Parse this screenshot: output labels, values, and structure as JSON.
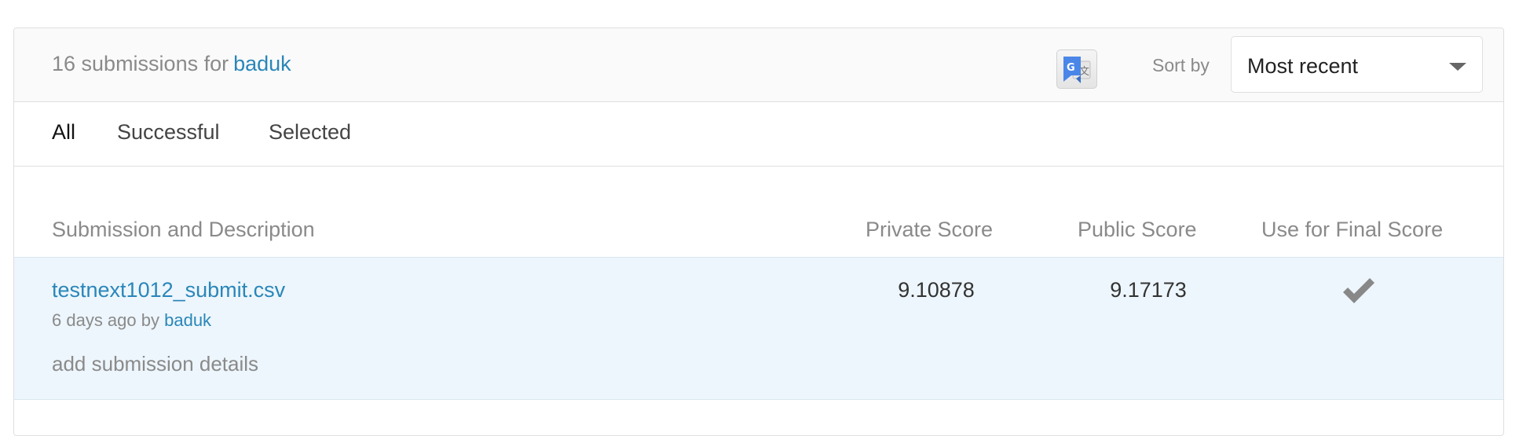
{
  "header": {
    "title_prefix": "16 submissions for",
    "user": "baduk",
    "sort_label": "Sort by",
    "sort_value": "Most recent"
  },
  "tabs": [
    {
      "label": "All",
      "active": true
    },
    {
      "label": "Successful",
      "active": false
    },
    {
      "label": "Selected",
      "active": false
    }
  ],
  "columns": {
    "submission": "Submission and Description",
    "private": "Private Score",
    "public": "Public Score",
    "final": "Use for Final Score"
  },
  "rows": [
    {
      "file": "testnext1012_submit.csv",
      "time": "6 days ago by",
      "user": "baduk",
      "details": "add submission details",
      "private_score": "9.10878",
      "public_score": "9.17173",
      "selected_icon": "checkmark-icon"
    }
  ],
  "colors": {
    "link": "#2a86b9",
    "row_highlight": "#edf6fc",
    "muted": "#8a8a8a",
    "check": "#888888"
  }
}
